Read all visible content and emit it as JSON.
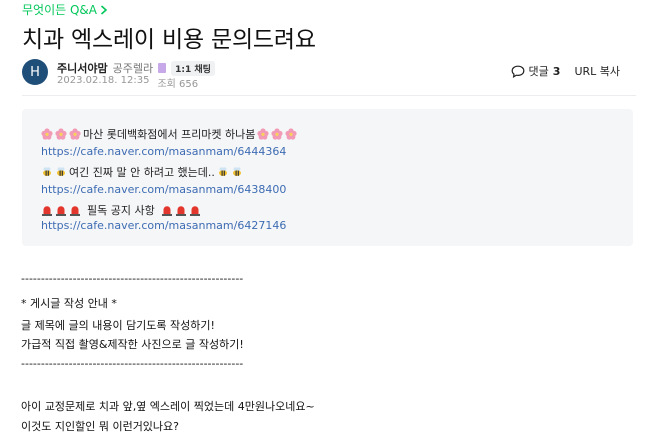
{
  "breadcrumb": {
    "board": "무엇이든 Q&A"
  },
  "post": {
    "title": "치과 엑스레이 비용 문의드려요",
    "author_initial": "H",
    "author": "주니서야맘",
    "grade": "공주렐라",
    "chat_label": "1:1 채팅",
    "date": "2023.02.18. 12:35",
    "views_label": "조회 656"
  },
  "tools": {
    "comment_label": "댓글",
    "comment_count": "3",
    "url_label": "URL 복사"
  },
  "notice": {
    "line1": "마산 롯데백화점에서 프리마켓 하나봄",
    "link1": "https://cafe.naver.com/masanmam/6444364",
    "line2": "여긴 진짜 말 안 하려고 했는데..",
    "link2": "https://cafe.naver.com/masanmam/6438400",
    "line3": "필독 공지 사항",
    "link3": "https://cafe.naver.com/masanmam/6427146"
  },
  "body": {
    "sep1": "--------------------------------------------------------",
    "guide_title": "* 게시글 작성 안내 *",
    "guide1": "글 제목에 글의 내용이 담기도록 작성하기!",
    "guide2": "가급적 직접 촬영&제작한 사진으로 글 작성하기!",
    "sep2": "--------------------------------------------------------",
    "text1": "아이 교정문제로 치과 앞,옆 엑스레이 찍었는데 4만원나오네요~",
    "text2": "이것도 지인할인 뭐 이런거있나요?"
  },
  "colors": {
    "accent": "#03c75a",
    "link": "#3d6cb3",
    "notice_bg": "#f5f6f8"
  },
  "icons": [
    "chevron-right-icon",
    "grade-icon",
    "comment-icon",
    "flower-icon",
    "bee-icon",
    "siren-icon"
  ]
}
